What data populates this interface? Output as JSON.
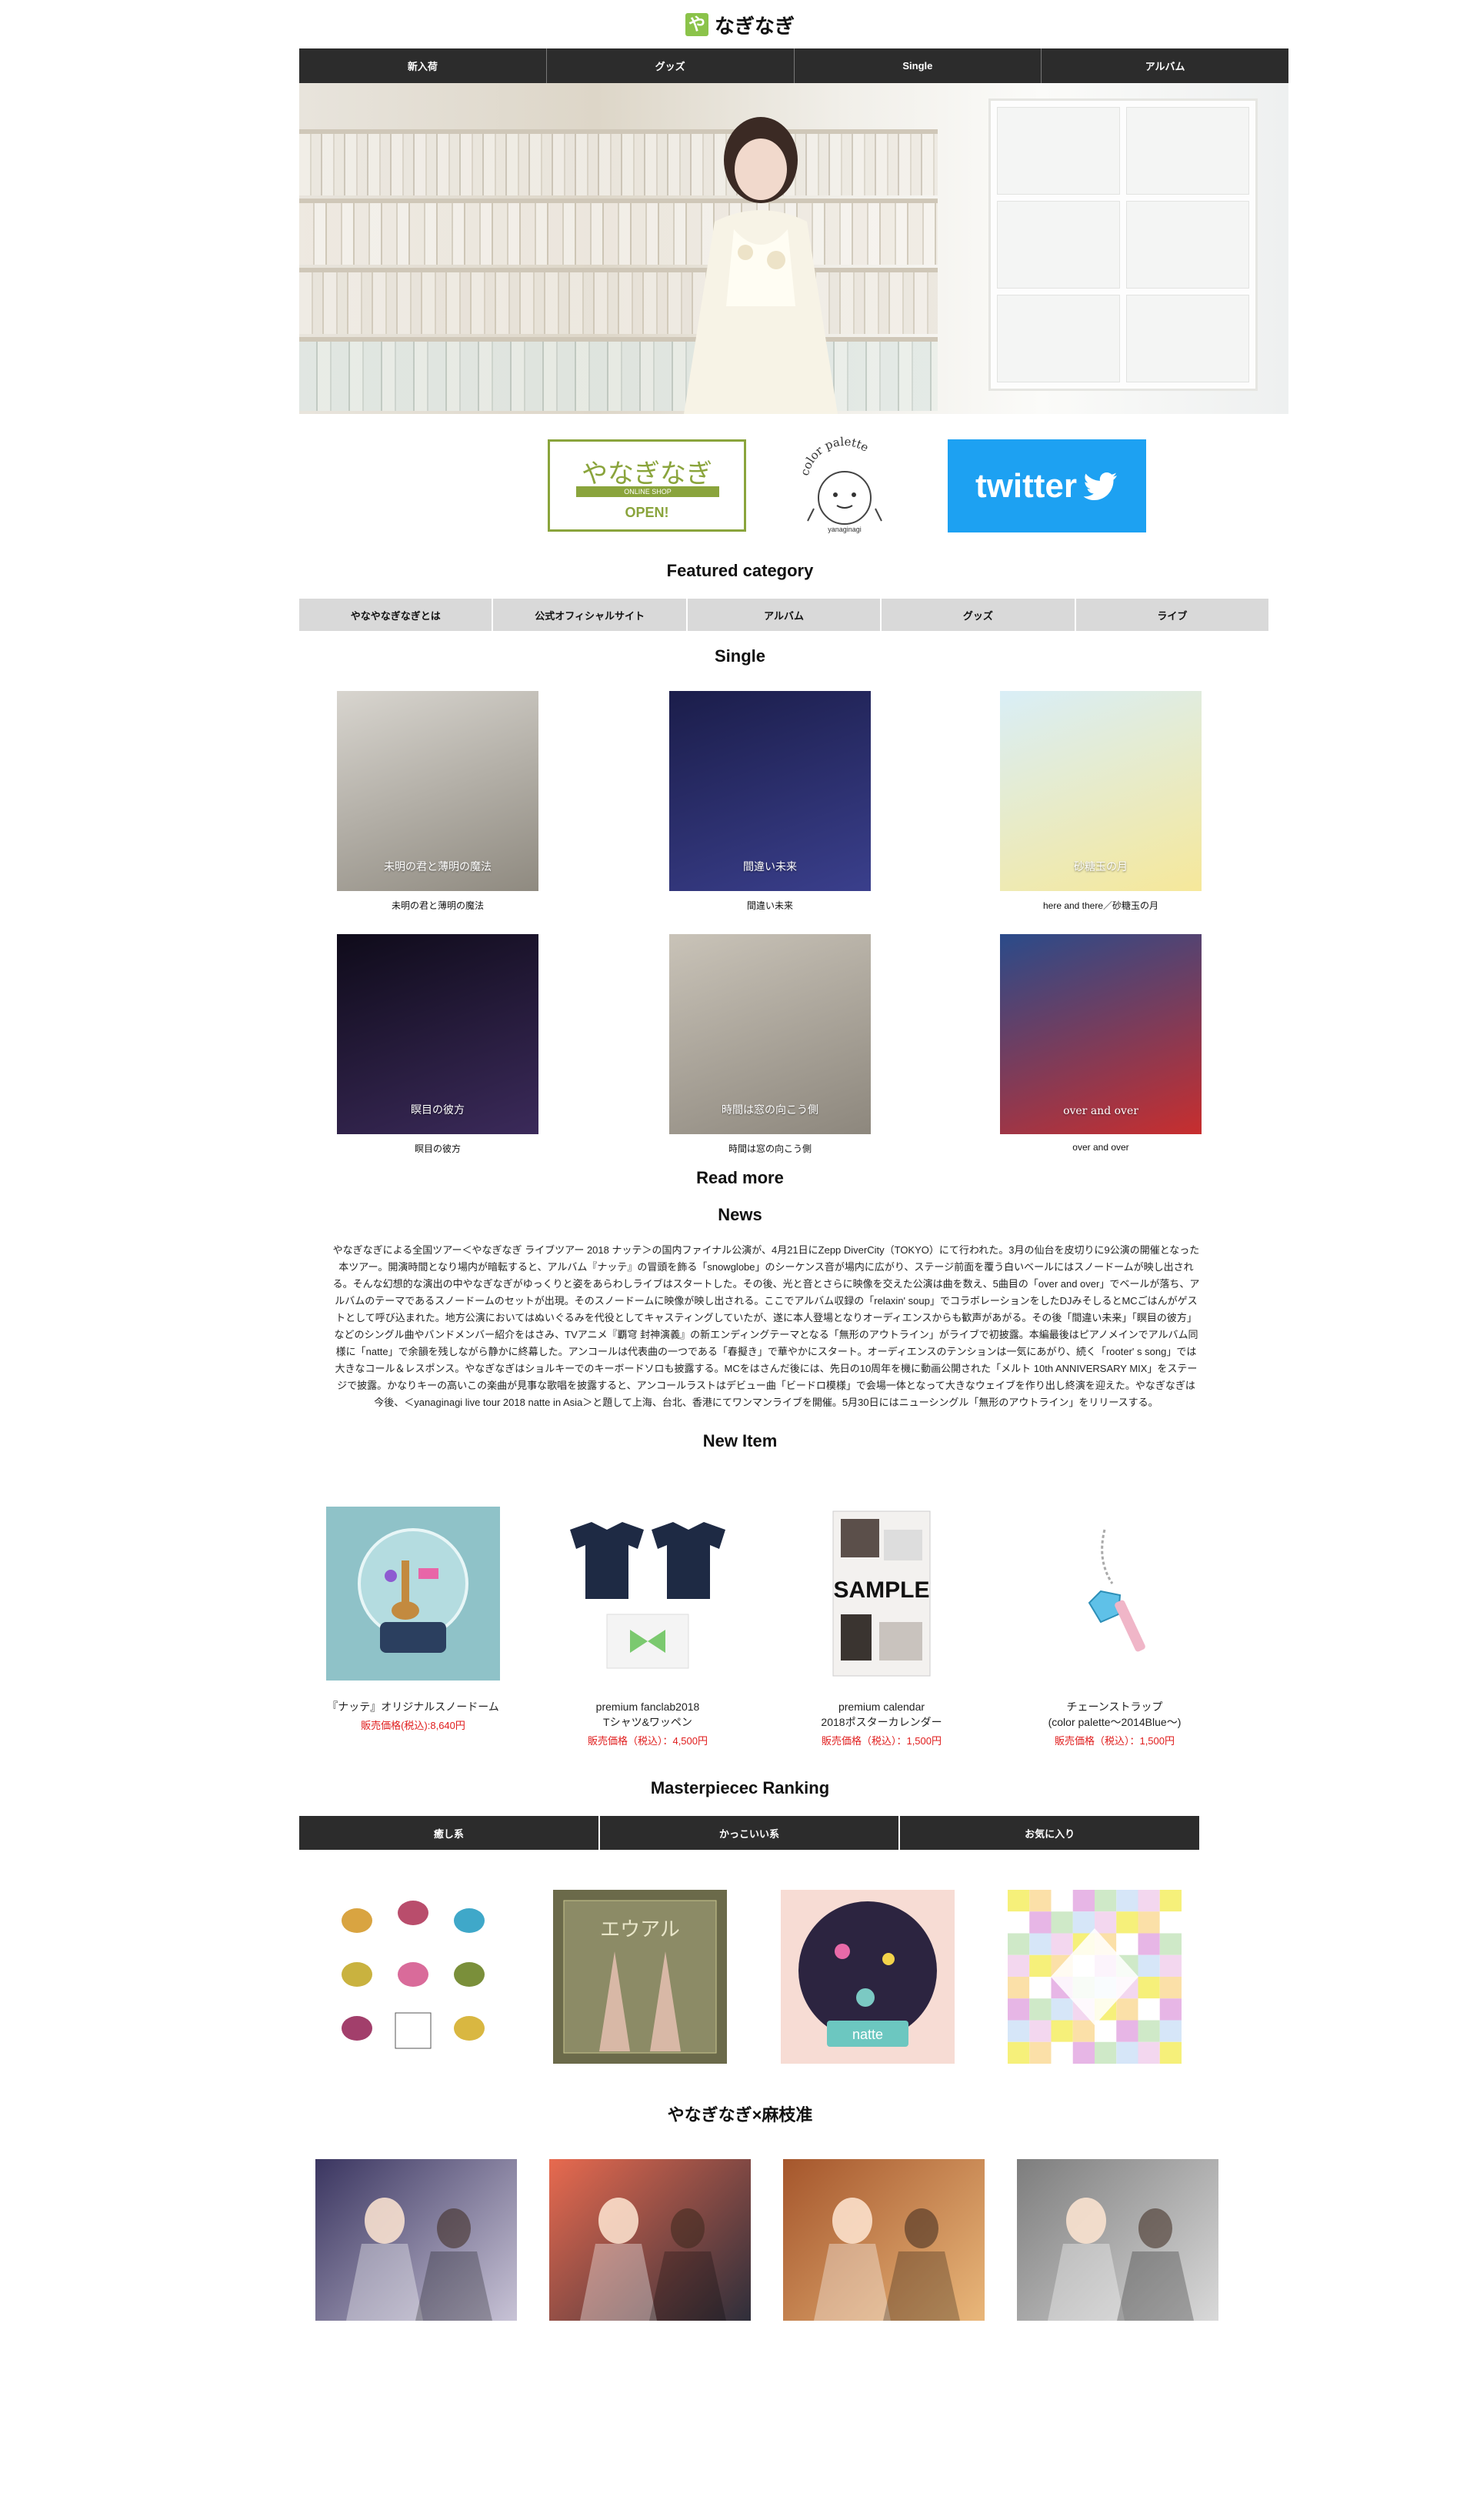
{
  "header": {
    "logo_mark": "や",
    "title": "なぎなぎ"
  },
  "top_nav": [
    "新入荷",
    "グッズ",
    "Single",
    "アルバム"
  ],
  "banners": {
    "shop": {
      "title": "やなぎなぎ",
      "subtitle": "ONLINE SHOP",
      "status": "OPEN!"
    },
    "palette": {
      "title": "color palette",
      "subtitle": "yanaginagi"
    },
    "twitter": {
      "label": "twitter"
    }
  },
  "featured": {
    "title": "Featured category",
    "items": [
      "やなやなぎなぎとは",
      "公式オフィシャルサイト",
      "アルバム",
      "グッズ",
      "ライブ"
    ]
  },
  "single": {
    "title": "Single",
    "items": [
      {
        "caption": "未明の君と薄明の魔法",
        "cover_text": "未明の君と薄明の魔法",
        "colors": [
          "#d8d5cf",
          "#8f8a80"
        ]
      },
      {
        "caption": "間違い未来",
        "cover_text": "間違い未来",
        "colors": [
          "#1b1d4a",
          "#3a3f8c"
        ]
      },
      {
        "caption": "here and there／砂糖玉の月",
        "cover_text": "砂糖玉の月",
        "colors": [
          "#d9eef7",
          "#f6e89a"
        ]
      },
      {
        "caption": "瞑目の彼方",
        "cover_text": "瞑目の彼方",
        "colors": [
          "#0f0b1a",
          "#3b2a5a"
        ]
      },
      {
        "caption": "時間は窓の向こう側",
        "cover_text": "時間は窓の向こう側",
        "colors": [
          "#c9c3b8",
          "#8d877d"
        ]
      },
      {
        "caption": "over and over",
        "cover_text": "over and over",
        "colors": [
          "#2a4b8a",
          "#c82e2e"
        ]
      }
    ],
    "read_more": "Read more"
  },
  "news": {
    "title": "News",
    "body": "やなぎなぎによる全国ツアー＜やなぎなぎ ライブツアー 2018 ナッテ＞の国内ファイナル公演が、4月21日にZepp DiverCity（TOKYO）にて行われた。3月の仙台を皮切りに9公演の開催となった本ツアー。開演時間となり場内が暗転すると、アルバム『ナッテ』の冒頭を飾る「snowglobe」のシーケンス音が場内に広がり、ステージ前面を覆う白いベールにはスノードームが映し出される。そんな幻想的な演出の中やなぎなぎがゆっくりと姿をあらわしライブはスタートした。その後、光と音とさらに映像を交えた公演は曲を数え、5曲目の「over and over」でベールが落ち、アルバムのテーマであるスノードームのセットが出現。そのスノードームに映像が映し出される。ここでアルバム収録の「relaxin' soup」でコラボレーションをしたDJみそしるとMCごはんがゲストとして呼び込まれた。地方公演においてはぬいぐるみを代役としてキャスティングしていたが、遂に本人登場となりオーディエンスからも歓声があがる。その後「間違い未来」「瞑目の彼方」などのシングル曲やバンドメンバー紹介をはさみ、TVアニメ『覇穹 封神演義』の新エンディングテーマとなる「無形のアウトライン」がライブで初披露。本編最後はピアノメインでアルバム同様に「natte」で余韻を残しながら静かに終幕した。アンコールは代表曲の一つである「春擬き」で華やかにスタート。オーディエンスのテンションは一気にあがり、続く「rooter' s song」では大きなコール＆レスポンス。やなぎなぎはショルキーでのキーボードソロも披露する。MCをはさんだ後には、先日の10周年を機に動画公開された「メルト 10th ANNIVERSARY MIX」をステージで披露。かなりキーの高いこの楽曲が見事な歌唱を披露すると、アンコールラストはデビュー曲「ビードロ模様」で会場一体となって大きなウェイブを作り出し終演を迎えた。やなぎなぎは今後、＜yanaginagi live tour 2018 natte in Asia＞と題して上海、台北、香港にてワンマンライブを開催。5月30日にはニューシングル「無形のアウトライン」をリリースする。"
  },
  "new_item": {
    "title": "New Item",
    "items": [
      {
        "name_lines": [
          "『ナッテ』オリジナルスノードーム"
        ],
        "price": "販売価格(税込):8,640円"
      },
      {
        "name_lines": [
          "premium fanclab2018",
          "Tシャツ&ワッペン"
        ],
        "price": "販売価格（税込）：4,500円"
      },
      {
        "name_lines": [
          "premium calendar",
          "2018ポスターカレンダー"
        ],
        "price": "販売価格（税込）：1,500円",
        "image_text": "SAMPLE"
      },
      {
        "name_lines": [
          "チェーンストラップ",
          "(color palette〜2014Blue〜)"
        ],
        "price": "販売価格（税込）：1,500円"
      }
    ]
  },
  "ranking": {
    "title": "Masterpiecec Ranking",
    "tabs": [
      "癒し系",
      "かっこいい系",
      "お気に入り"
    ],
    "covers": [
      {
        "label": "",
        "colors": [
          "#ffffff",
          "#f3efe6"
        ]
      },
      {
        "label": "エウアル",
        "colors": [
          "#6b6a4a",
          "#8c8b66"
        ]
      },
      {
        "label": "natte",
        "colors": [
          "#f7dcd4",
          "#2c2440"
        ]
      },
      {
        "label": "",
        "colors": [
          "#f6f07a",
          "#e7b6e6"
        ]
      }
    ]
  },
  "collab": {
    "title": "やなぎなぎ×麻枝准",
    "images": [
      {
        "colors": [
          "#3a3560",
          "#c8c3d6"
        ]
      },
      {
        "colors": [
          "#e86a4f",
          "#2e2e3a"
        ]
      },
      {
        "colors": [
          "#a5562c",
          "#e9b77a"
        ]
      },
      {
        "colors": [
          "#7d7d7d",
          "#d9d9d9"
        ]
      }
    ]
  }
}
